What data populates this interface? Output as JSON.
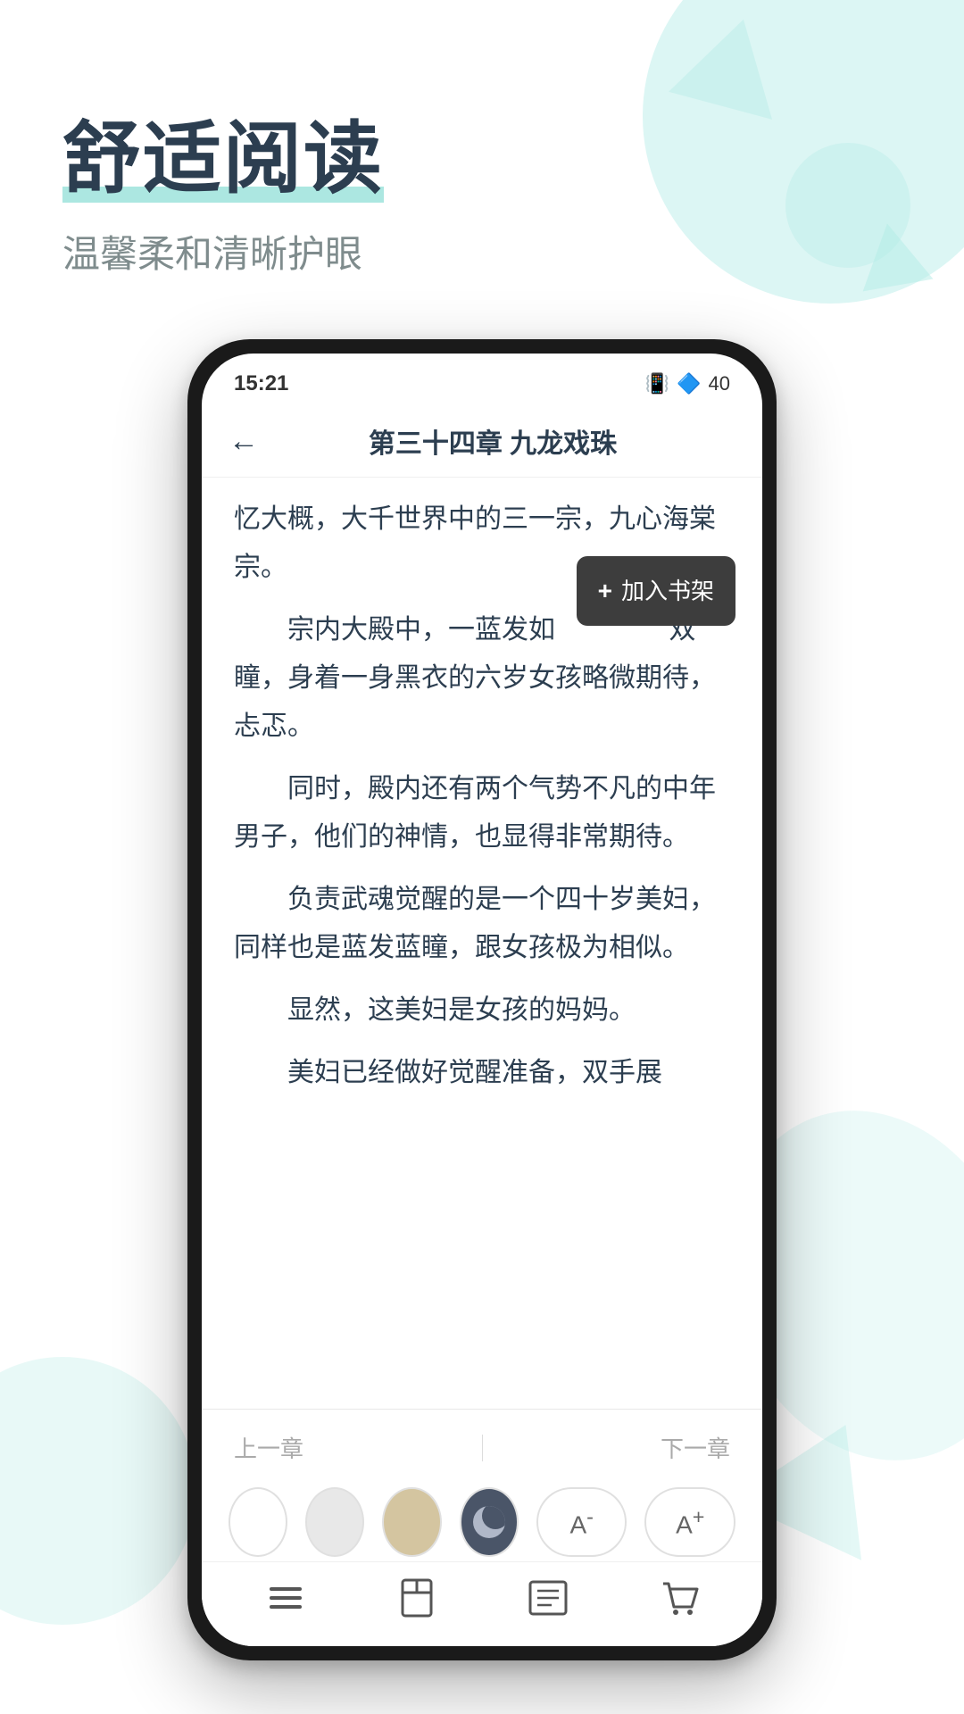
{
  "background": {
    "color": "#ffffff",
    "accent": "#5acfc4",
    "deco_color": "#b2ece6"
  },
  "header": {
    "main_title": "舒适阅读",
    "sub_title": "温馨柔和清晰护眼"
  },
  "phone": {
    "status_bar": {
      "time": "15:21",
      "battery_level": "40"
    },
    "chapter_header": {
      "back_label": "←",
      "title": "第三十四章 九龙戏珠"
    },
    "tooltip": {
      "label": "加入书架"
    },
    "content": {
      "paragraphs": [
        "忆大概，大千世界中的三一宗，九心海棠宗。",
        "宗内大殿中，一蓝发如双瞳，身着一身黑衣的六岁女孩略微期待，忐忑。",
        "同时，殿内还有两个气势不凡的中年男子，他们的神情，也显得非常期待。",
        "负责武魂觉醒的是一个四十岁美妇，同样也是蓝发蓝瞳，跟女孩极为相似。",
        "显然，这美妇是女孩的妈妈。",
        "美妇已经做好觉醒准备，双手展"
      ]
    },
    "chapter_nav": {
      "prev": "上一章",
      "next": "下一章"
    },
    "theme_buttons": [
      {
        "id": "white",
        "label": "白色"
      },
      {
        "id": "light_gray",
        "label": "浅灰"
      },
      {
        "id": "beige",
        "label": "米色"
      },
      {
        "id": "dark",
        "label": "夜间"
      }
    ],
    "font_buttons": {
      "decrease": "A⁻",
      "increase": "A⁺"
    },
    "bottom_nav": [
      {
        "id": "menu",
        "label": "目录"
      },
      {
        "id": "bookmark",
        "label": "书签"
      },
      {
        "id": "content",
        "label": "内容"
      },
      {
        "id": "cart",
        "label": "购买"
      }
    ]
  }
}
